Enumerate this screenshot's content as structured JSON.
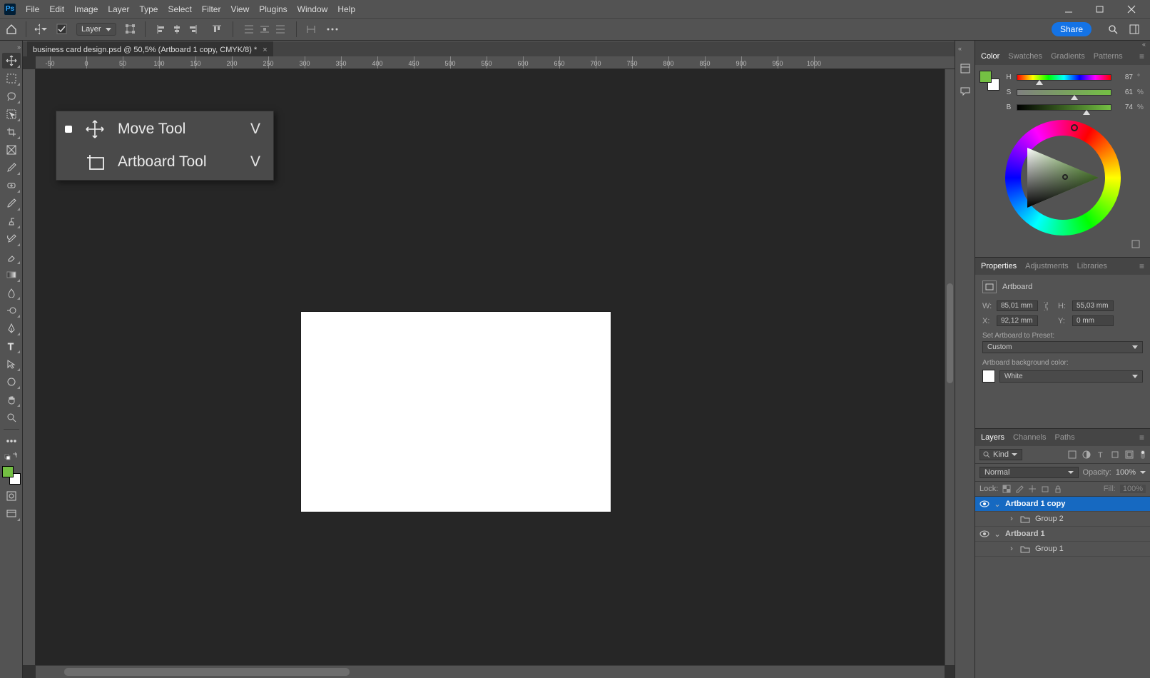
{
  "menubar": {
    "items": [
      "File",
      "Edit",
      "Image",
      "Layer",
      "Type",
      "Select",
      "Filter",
      "View",
      "Plugins",
      "Window",
      "Help"
    ]
  },
  "optionsbar": {
    "layer_mode": "Layer",
    "share": "Share"
  },
  "doc_tab": {
    "title": "business card design.psd @ 50,5% (Artboard 1 copy, CMYK/8) *"
  },
  "flyout": {
    "items": [
      {
        "name": "Move Tool",
        "shortcut": "V",
        "selected": true
      },
      {
        "name": "Artboard Tool",
        "shortcut": "V",
        "selected": false
      }
    ]
  },
  "ruler_h_ticks": [
    "-50",
    "0",
    "50",
    "100",
    "150",
    "200",
    "250",
    "300",
    "350",
    "400",
    "450",
    "500",
    "550",
    "600",
    "650",
    "700",
    "750",
    "800",
    "850",
    "900",
    "950",
    "1000"
  ],
  "color": {
    "tabs": [
      "Color",
      "Swatches",
      "Gradients",
      "Patterns"
    ],
    "h": {
      "label": "H",
      "value": "87",
      "unit": "°",
      "pos": 24
    },
    "s": {
      "label": "S",
      "value": "61",
      "unit": "%",
      "pos": 61
    },
    "b": {
      "label": "B",
      "value": "74",
      "unit": "%",
      "pos": 74
    }
  },
  "properties": {
    "tabs": [
      "Properties",
      "Adjustments",
      "Libraries"
    ],
    "type": "Artboard",
    "w_label": "W:",
    "w_value": "85,01 mm",
    "h_label": "H:",
    "h_value": "55,03 mm",
    "x_label": "X:",
    "x_value": "92,12 mm",
    "y_label": "Y:",
    "y_value": "0 mm",
    "preset_label": "Set Artboard to Preset:",
    "preset_value": "Custom",
    "bgcolor_label": "Artboard background color:",
    "bgcolor_value": "White"
  },
  "layers": {
    "tabs": [
      "Layers",
      "Channels",
      "Paths"
    ],
    "kind_label": "Kind",
    "blend_mode": "Normal",
    "opacity_label": "Opacity:",
    "opacity_value": "100%",
    "lock_label": "Lock:",
    "fill_label": "Fill:",
    "fill_value": "100%",
    "items": [
      {
        "name": "Artboard 1 copy",
        "type": "artboard",
        "active": true,
        "visible": true
      },
      {
        "name": "Group 2",
        "type": "group",
        "active": false,
        "visible": false,
        "child": true
      },
      {
        "name": "Artboard 1",
        "type": "artboard",
        "active": false,
        "visible": true
      },
      {
        "name": "Group 1",
        "type": "group",
        "active": false,
        "visible": false,
        "child": true
      }
    ]
  }
}
